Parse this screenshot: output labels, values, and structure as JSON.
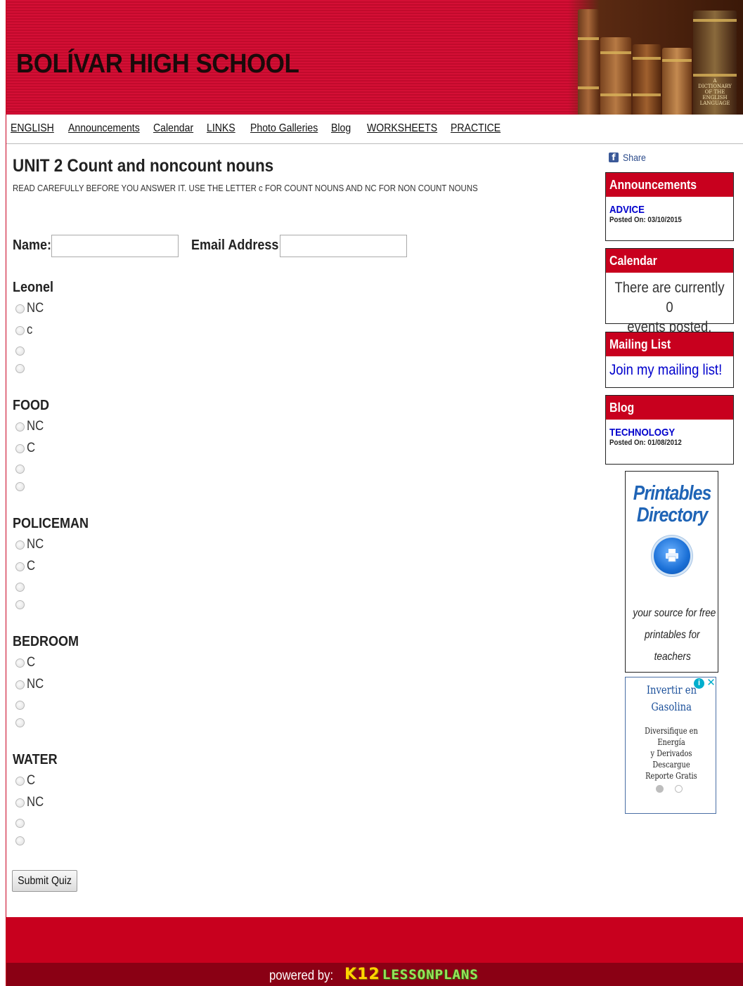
{
  "header": {
    "site_title": "BOLÍVAR HIGH SCHOOL",
    "book_label": "A DICTIONARY OF THE ENGLISH LANGUAGE"
  },
  "nav": {
    "items": [
      "ENGLISH",
      "Announcements",
      "Calendar",
      "LINKS",
      "Photo Galleries",
      "Blog",
      "WORKSHEETS",
      "PRACTICE"
    ]
  },
  "quiz": {
    "title": "UNIT 2 Count and noncount nouns",
    "instructions": "READ CAREFULLY BEFORE YOU ANSWER IT. USE THE LETTER c FOR COUNT NOUNS AND NC FOR NON COUNT NOUNS",
    "name_label": "Name:",
    "email_label": "Email Address:",
    "name_value": "",
    "email_value": "",
    "questions": [
      {
        "label": "Leonel",
        "options": [
          "NC",
          "c",
          "",
          ""
        ]
      },
      {
        "label": "FOOD",
        "options": [
          "NC",
          "C",
          "",
          ""
        ]
      },
      {
        "label": "POLICEMAN",
        "options": [
          "NC",
          "C",
          "",
          ""
        ]
      },
      {
        "label": "BEDROOM",
        "options": [
          "C",
          "NC",
          "",
          ""
        ]
      },
      {
        "label": "WATER",
        "options": [
          "C",
          "NC",
          "",
          ""
        ]
      }
    ],
    "submit_label": "Submit Quiz"
  },
  "sidebar": {
    "share_label": "Share",
    "announcements": {
      "heading": "Announcements",
      "link": "ADVICE",
      "posted": "Posted On: 03/10/2015"
    },
    "calendar": {
      "heading": "Calendar",
      "line1": "There are currently 0",
      "line2": "events posted."
    },
    "mailing": {
      "heading": "Mailing List",
      "link": "Join my mailing list!"
    },
    "blog": {
      "heading": "Blog",
      "link": "TECHNOLOGY",
      "posted": "Posted On: 01/08/2012"
    },
    "printables": {
      "title_line1": "Printables",
      "title_line2": "Directory",
      "tag1": "your source for free",
      "tag2": "printables for",
      "tag3": "teachers"
    },
    "ad": {
      "title_line1": "Invertir en",
      "title_line2": "Gasolina",
      "body_line1": "Diversifique en Energía",
      "body_line2": "y Derivados Descargue",
      "body_line3": "Reporte Gratis",
      "info": "i",
      "close": "✕"
    }
  },
  "footer": {
    "powered_by": "powered by:",
    "brand_k12": "K12",
    "brand_lessonplans": "LESSONPLANS"
  },
  "colors": {
    "brand_red": "#c8001e",
    "footer_dark": "#8a0014",
    "link_blue": "#0000cc"
  }
}
